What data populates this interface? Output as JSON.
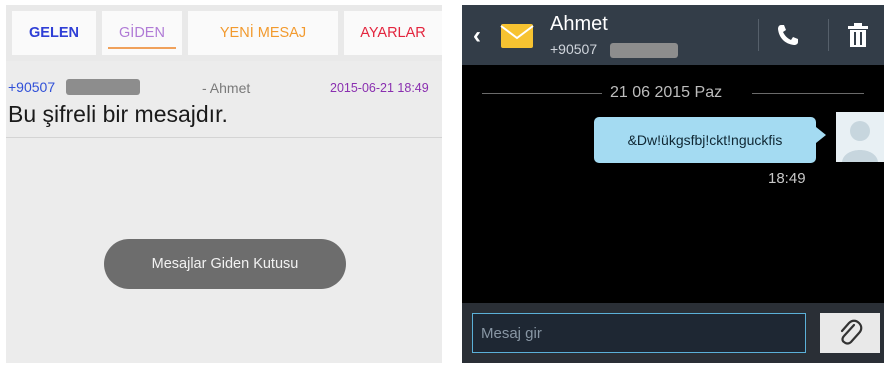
{
  "left": {
    "tabs": [
      {
        "label": "GELEN"
      },
      {
        "label": "GİDEN"
      },
      {
        "label": "YENİ MESAJ"
      },
      {
        "label": "AYARLAR"
      }
    ],
    "message": {
      "number": "+90507",
      "sender": "- Ahmet",
      "date": "2015-06-21 18:49",
      "body": "Bu şifreli bir mesajdır."
    },
    "toast": "Mesajlar Giden Kutusu"
  },
  "right": {
    "contact_name": "Ahmet",
    "contact_number": "+90507",
    "date_separator": "21 06 2015 Paz",
    "bubble_text": "&Dw!ükgsfbj!ckt!nguckfis",
    "time": "18:49",
    "input_placeholder": "Mesaj gir"
  },
  "icons": {
    "back": "chevron-left-icon",
    "envelope": "envelope-icon",
    "call": "phone-icon",
    "delete": "trash-icon",
    "avatar": "avatar-icon",
    "attach": "paperclip-icon"
  },
  "colors": {
    "gelen": "#2f3fd6",
    "giden": "#b07bd6",
    "yeni": "#f29a2e",
    "ayarlar": "#e3253e",
    "header_bg": "#333d48",
    "bubble": "#a4dbf2",
    "input_border": "#5bb0d8"
  }
}
